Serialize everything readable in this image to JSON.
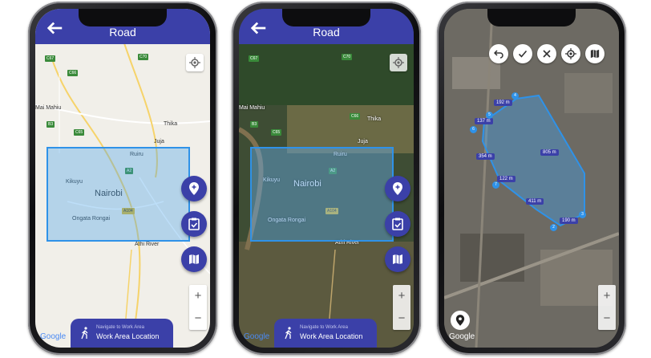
{
  "phones": [
    {
      "title": "Road",
      "map_style": "road",
      "places": {
        "mai_mahiu": "Mai Mahiu",
        "thika": "Thika",
        "juja": "Juja",
        "ruiru": "Ruiru",
        "kikuyu": "Kikuyu",
        "nairobi": "Nairobi",
        "ongata_rongai": "Ongata Rongai",
        "athi_river": "Athi River"
      },
      "roads": {
        "c67": "C67",
        "c70": "C70",
        "c66": "C66",
        "b3": "B3",
        "c65": "C65",
        "a2": "A2",
        "a104": "A104"
      },
      "zoom_in": "+",
      "zoom_out": "−",
      "attribution": "Google",
      "nav_panel": {
        "subtitle": "Navigate to Work Area",
        "title": "Work Area Location"
      }
    },
    {
      "title": "Road",
      "map_style": "satellite",
      "places": {
        "mai_mahiu": "Mai Mahiu",
        "thika": "Thika",
        "juja": "Juja",
        "ruiru": "Ruiru",
        "kikuyu": "Kikuyu",
        "nairobi": "Nairobi",
        "ongata_rongai": "Ongata Rongai",
        "athi_river": "Athi River"
      },
      "roads": {
        "c67": "C67",
        "c70": "C70",
        "c66": "C66",
        "b3": "B3",
        "c65": "C65",
        "a2": "A2",
        "a104": "A104"
      },
      "zoom_in": "+",
      "zoom_out": "−",
      "attribution": "Google",
      "nav_panel": {
        "subtitle": "Navigate to Work Area",
        "title": "Work Area Location"
      }
    },
    {
      "map_style": "satellite",
      "distances": [
        "192 m",
        "137 m",
        "354 m",
        "805 m",
        "122 m",
        "411 m",
        "190 m"
      ],
      "vertices": [
        "4",
        "5",
        "6",
        "7",
        "2",
        "3"
      ],
      "zoom_in": "+",
      "zoom_out": "−",
      "attribution": "Google"
    }
  ],
  "colors": {
    "primary": "#3b40a8",
    "area_fill": "#42a0eb",
    "area_border": "#2f92e8"
  }
}
